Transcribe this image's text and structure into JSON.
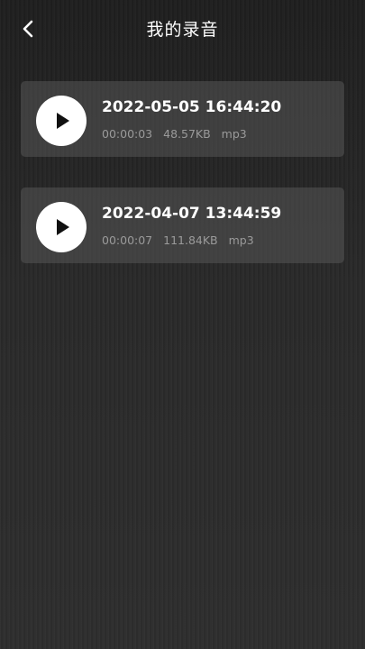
{
  "header": {
    "title": "我的录音",
    "back_icon": "chevron-left-icon"
  },
  "recordings": [
    {
      "title": "2022-05-05 16:44:20",
      "duration": "00:00:03",
      "size": "48.57KB",
      "format": "mp3",
      "icon": "play-icon"
    },
    {
      "title": "2022-04-07 13:44:59",
      "duration": "00:00:07",
      "size": "111.84KB",
      "format": "mp3",
      "icon": "play-icon"
    }
  ],
  "colors": {
    "background": "#262626",
    "card": "#4a4a4a",
    "text_primary": "#ffffff",
    "text_secondary": "#9a9a9a",
    "play_button": "#ffffff",
    "play_glyph": "#111111"
  }
}
